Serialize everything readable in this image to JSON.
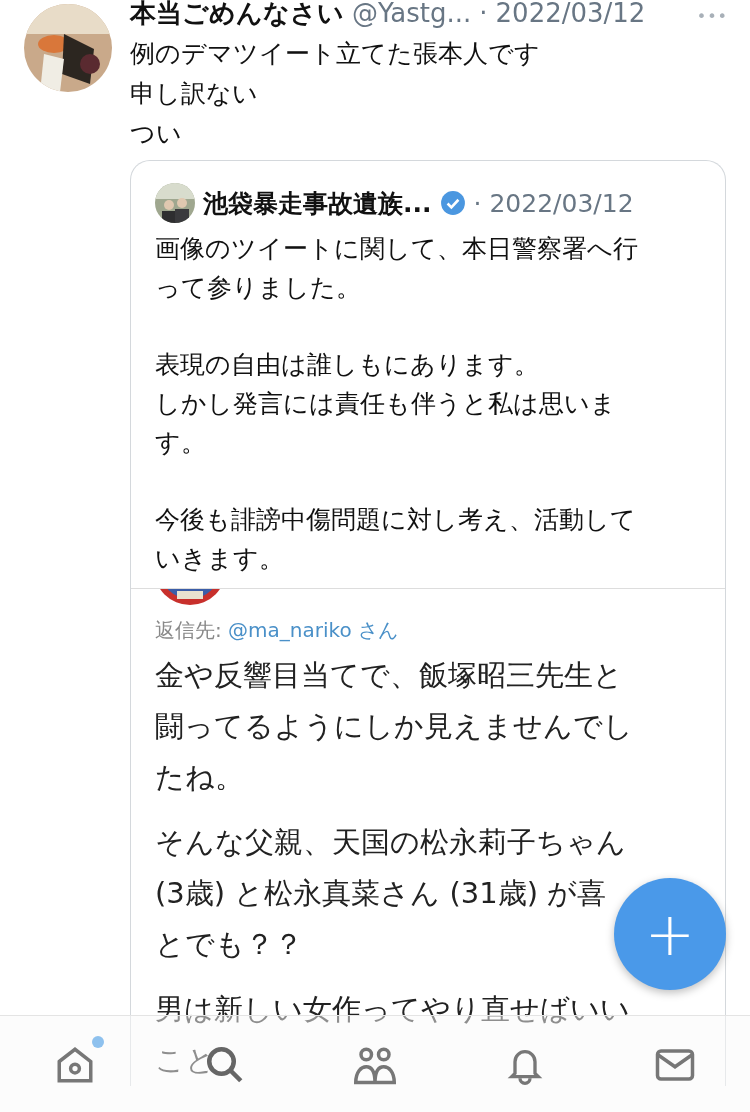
{
  "tweet": {
    "name": "本当ごめんなさい",
    "handle": "@Yastg...",
    "separator": "·",
    "date": "2022/03/12",
    "more": "•••",
    "text_lines": [
      "例のデマツイート立てた張本人です",
      "申し訳ない",
      "つい"
    ]
  },
  "quote": {
    "name": "池袋暴走事故遺族...",
    "verified": true,
    "separator": "·",
    "date": "2022/03/12",
    "paragraphs": [
      [
        "画像のツイートに関して、本日警察署へ行",
        "って参りました。"
      ],
      [
        "表現の自由は誰しもにあります。",
        "しかし発言には責任も伴うと私は思いま",
        "す。"
      ],
      [
        "今後も誹謗中傷問題に対し考え、活動して",
        "いきます。"
      ]
    ],
    "image": {
      "reply_label": "返信先:",
      "reply_handle": "@ma_nariko",
      "reply_suffix": "さん",
      "paragraphs": [
        [
          "金や反響目当てで、飯塚昭三先生と",
          "闘ってるようにしか見えませんでし",
          "たね。"
        ],
        [
          "そんな父親、天国の松永莉子ちゃん",
          "(3歳) と松永真菜さん (31歳) が喜",
          "とでも？？"
        ],
        [
          "男は新しい女作ってやり直せばいい",
          "こと"
        ]
      ]
    }
  },
  "compose_button": {
    "label": "+"
  },
  "tab_bar": [
    {
      "kind": "home",
      "unread": true
    },
    {
      "kind": "search",
      "unread": false
    },
    {
      "kind": "people",
      "unread": false
    },
    {
      "kind": "bell",
      "unread": false
    },
    {
      "kind": "mail",
      "unread": false
    }
  ]
}
